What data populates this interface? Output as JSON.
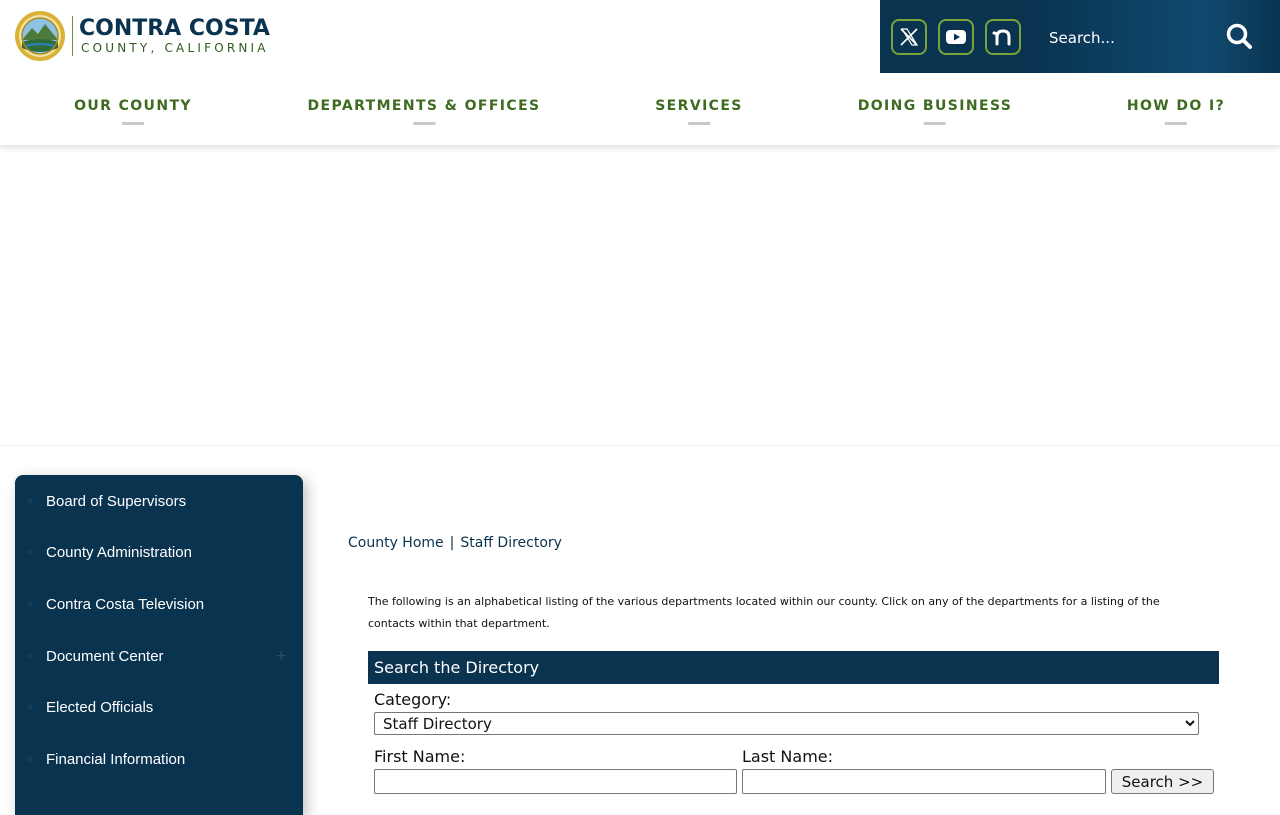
{
  "header": {
    "logo": {
      "name": "CONTRA COSTA",
      "subtitle": "COUNTY, CALIFORNIA"
    },
    "social": [
      {
        "icon": "x-twitter-icon"
      },
      {
        "icon": "youtube-icon"
      },
      {
        "icon": "nextdoor-icon"
      }
    ],
    "search": {
      "placeholder": "Search...",
      "icon": "search-icon"
    }
  },
  "nav": {
    "items": [
      {
        "label": "OUR COUNTY"
      },
      {
        "label": "DEPARTMENTS & OFFICES"
      },
      {
        "label": "SERVICES"
      },
      {
        "label": "DOING BUSINESS"
      },
      {
        "label": "HOW DO I?"
      }
    ]
  },
  "sidebar": {
    "items": [
      {
        "label": "Board of Supervisors"
      },
      {
        "label": "County Administration"
      },
      {
        "label": "Contra Costa Television"
      },
      {
        "label": "Document Center",
        "expand": "+"
      },
      {
        "label": "Elected Officials"
      },
      {
        "label": "Financial Information"
      }
    ]
  },
  "breadcrumb": {
    "home": "County Home",
    "separator": "|",
    "current": "Staff Directory"
  },
  "intro": {
    "text": "The following is an alphabetical listing of the various departments located within our county. Click on any of the departments for a listing of the contacts within that department."
  },
  "directory": {
    "title": "Search the Directory",
    "category_label": "Category:",
    "category_value": "Staff Directory",
    "first_name_label": "First Name:",
    "last_name_label": "Last Name:",
    "submit_label": "Search >>"
  },
  "colors": {
    "navy": "#0a3350",
    "green": "#3d6b1f",
    "icon_border": "#7aa33a"
  }
}
